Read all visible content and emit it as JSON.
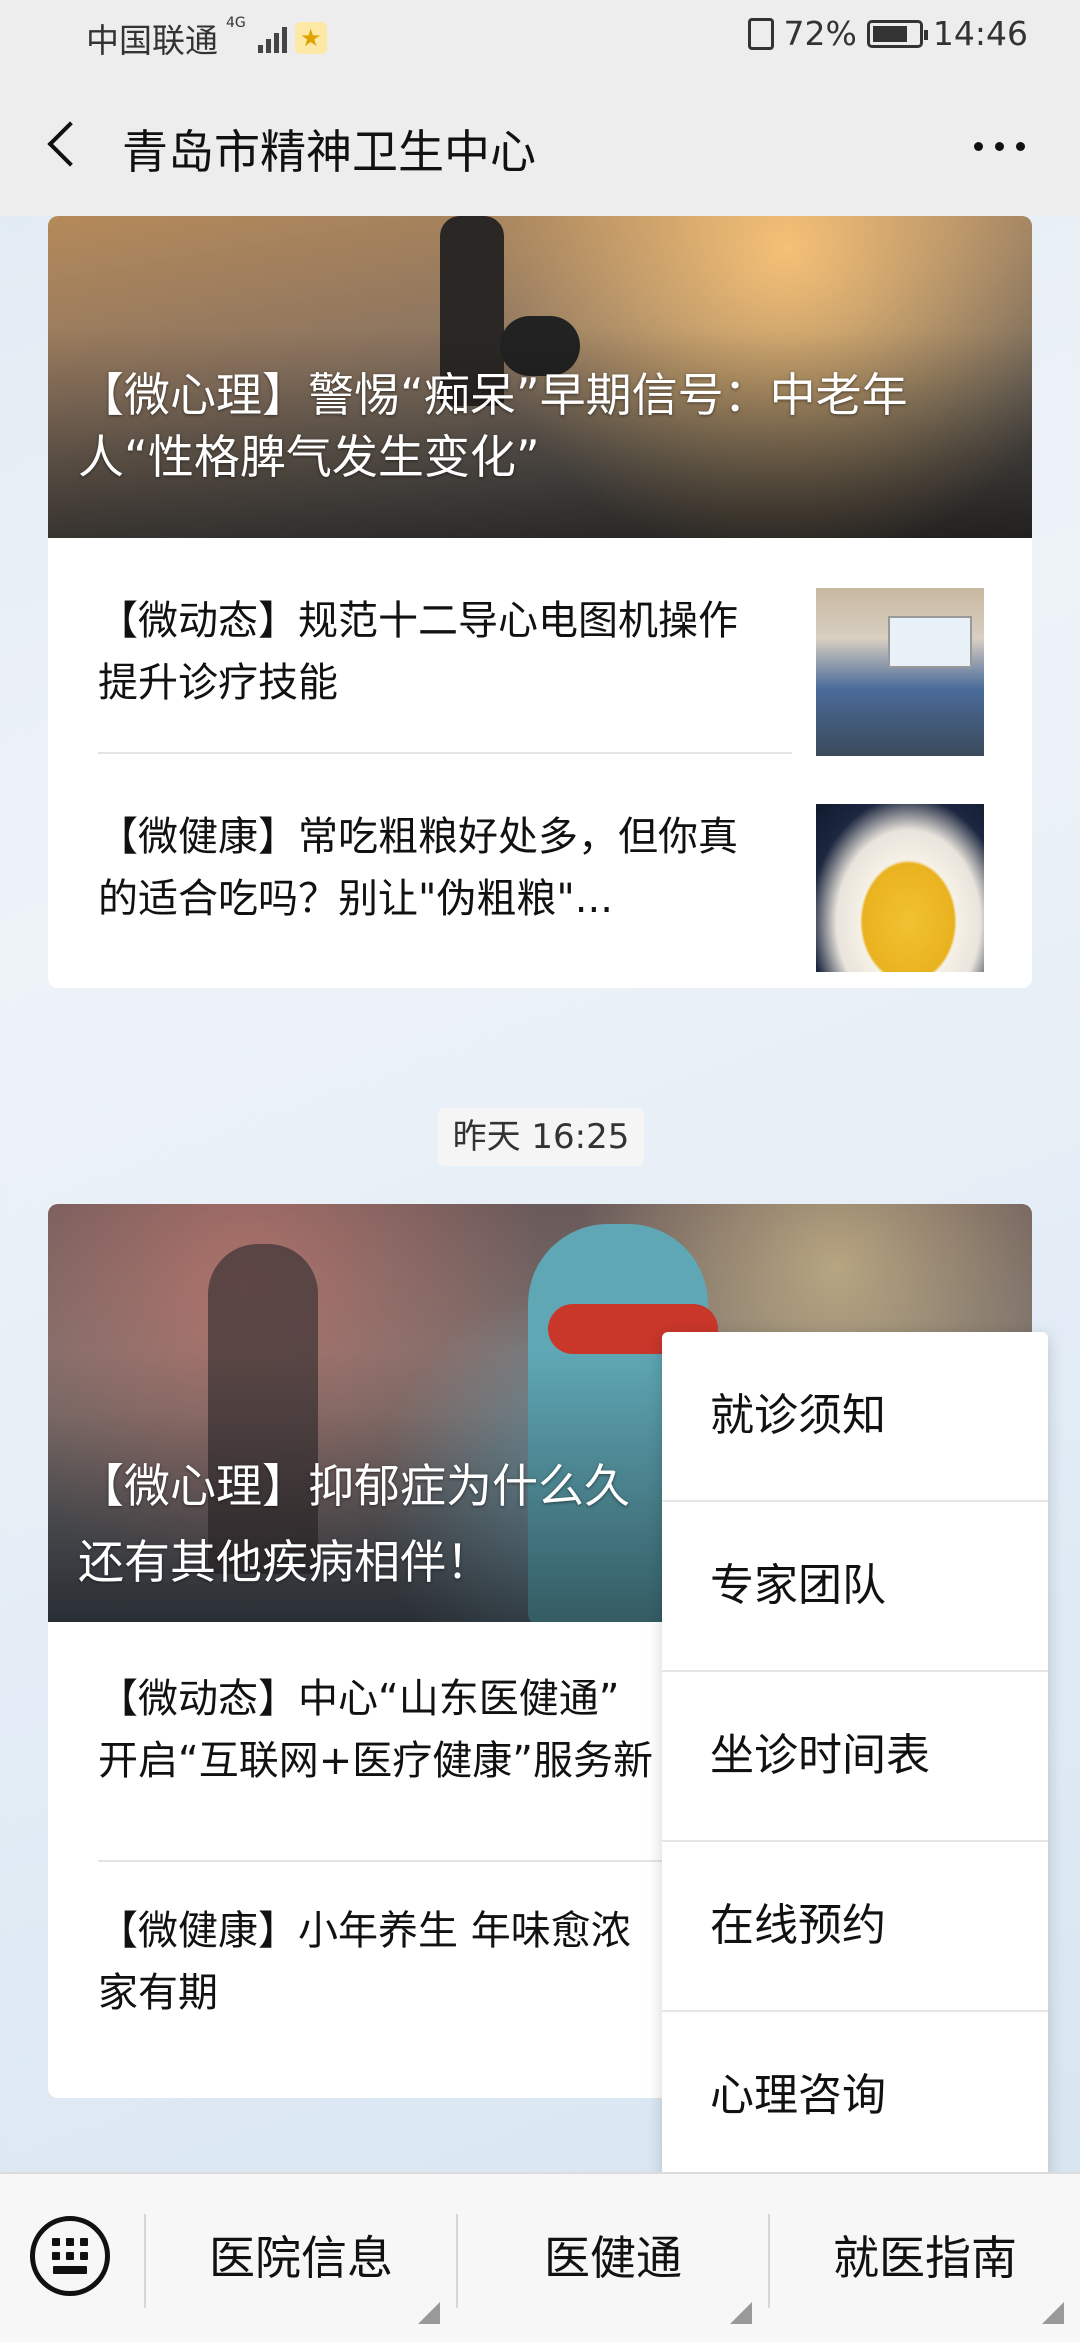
{
  "status_bar": {
    "carrier": "中国联通",
    "network": "4G",
    "battery_percent": "72%",
    "time": "14:46"
  },
  "nav": {
    "title": "青岛市精神卫生中心"
  },
  "card1": {
    "cover_title": "【微心理】警惕“痴呆”早期信号：中老年人“性格脾气发生变化”",
    "items": [
      {
        "title": "【微动态】规范十二导心电图机操作 提升诊疗技能"
      },
      {
        "title": "【微健康】常吃粗粮好处多，但你真的适合吃吗？别让\"伪粗粮\"..."
      }
    ]
  },
  "timestamp": "昨天 16:25",
  "card2": {
    "cover_title": "【微心理】抑郁症为什么久\n还有其他疾病相伴！",
    "items": [
      {
        "title": "【微动态】中心“山东医健通”\n开启“互联网+医疗健康”服务新"
      },
      {
        "title": "【微健康】小年养生 年味愈浓\n家有期"
      }
    ]
  },
  "popup_menu": {
    "items": [
      "就诊须知",
      "专家团队",
      "坐诊时间表",
      "在线预约",
      "心理咨询"
    ]
  },
  "bottom_menu": {
    "items": [
      "医院信息",
      "医健通",
      "就医指南"
    ]
  }
}
